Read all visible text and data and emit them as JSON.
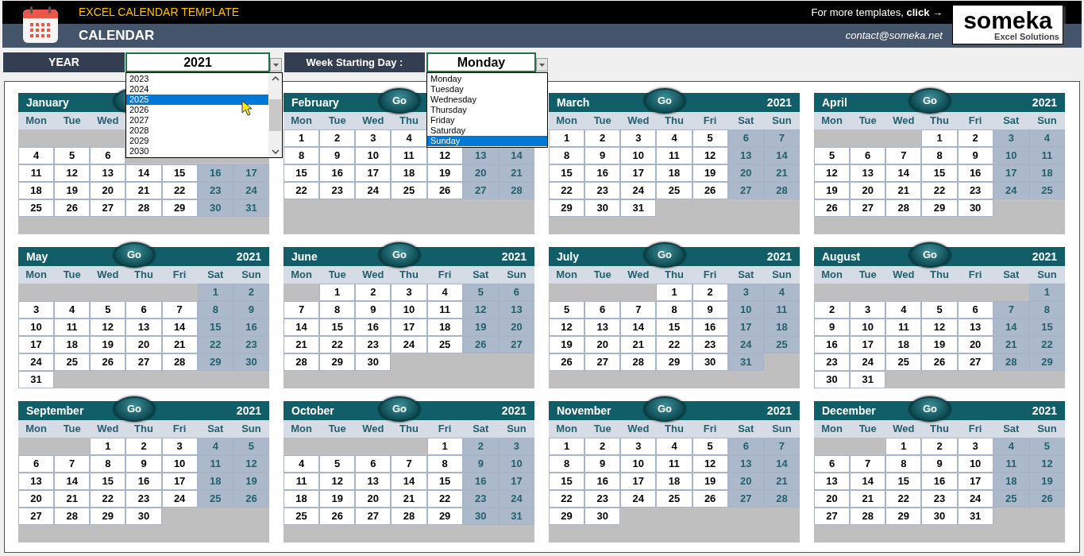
{
  "header": {
    "title": "EXCEL CALENDAR TEMPLATE",
    "subtitle": "CALENDAR",
    "promo": "For more templates, **click** →",
    "contact": "contact@someka.net",
    "logo": {
      "name": "someka",
      "tagline": "Excel Solutions"
    }
  },
  "controls": [
    {
      "label": "YEAR",
      "value": "2021"
    },
    {
      "label": "Week Starting Day :",
      "value": "Monday"
    }
  ],
  "year_dropdown": {
    "options": [
      {
        "label": "2023",
        "selected": false
      },
      {
        "label": "2024",
        "selected": false
      },
      {
        "label": "2025",
        "selected": true
      },
      {
        "label": "2026",
        "selected": false
      },
      {
        "label": "2027",
        "selected": false
      },
      {
        "label": "2028",
        "selected": false
      },
      {
        "label": "2029",
        "selected": false
      },
      {
        "label": "2030",
        "selected": false
      }
    ]
  },
  "weekday_dropdown": {
    "options": [
      {
        "label": "Monday",
        "selected": false
      },
      {
        "label": "Tuesday",
        "selected": false
      },
      {
        "label": "Wednesday",
        "selected": false
      },
      {
        "label": "Thursday",
        "selected": false
      },
      {
        "label": "Friday",
        "selected": false
      },
      {
        "label": "Saturday",
        "selected": false
      },
      {
        "label": "Sunday",
        "selected": true
      }
    ]
  },
  "months": [
    {
      "name": "January",
      "weekdays": [
        "Mon",
        "Tue",
        "Wed"
      ],
      "weeks": [
        {
          "kind": "blank"
        },
        {
          "kind": "week",
          "days": [
            "4",
            "5",
            "6"
          ]
        },
        {
          "kind": "week",
          "days": [
            "11",
            "12",
            "13",
            "14",
            "15",
            "16",
            "17"
          ]
        },
        {
          "kind": "week",
          "days": [
            "18",
            "19",
            "20",
            "21",
            "22",
            "23",
            "24"
          ]
        },
        {
          "kind": "week",
          "days": [
            "25",
            "26",
            "27",
            "28",
            "29",
            "30",
            "31"
          ]
        },
        {
          "kind": "blank"
        }
      ]
    },
    {
      "name": "February",
      "go": "Go",
      "weekdays": [
        "Mon",
        "Tue",
        "Wed",
        "Thu"
      ],
      "weeks": [
        {
          "kind": "week",
          "days": [
            "1",
            "2",
            "3",
            "4"
          ]
        },
        {
          "kind": "week",
          "days": [
            "8",
            "9",
            "10",
            "11",
            "12",
            "13",
            "14"
          ]
        },
        {
          "kind": "week",
          "days": [
            "15",
            "16",
            "17",
            "18",
            "19",
            "20",
            "21"
          ]
        },
        {
          "kind": "week",
          "days": [
            "22",
            "23",
            "24",
            "25",
            "26",
            "27",
            "28"
          ]
        },
        {
          "kind": "blank"
        },
        {
          "kind": "blank"
        }
      ]
    },
    {
      "name": "March",
      "go": "Go",
      "year": "2021",
      "weekdays": [
        "Mon",
        "Tue",
        "Wed",
        "Thu",
        "Fri",
        "Sat",
        "Sun"
      ],
      "weeks": [
        {
          "kind": "week",
          "days": [
            "1",
            "2",
            "3",
            "4",
            "5",
            "6",
            "7"
          ]
        },
        {
          "kind": "week",
          "days": [
            "8",
            "9",
            "10",
            "11",
            "12",
            "13",
            "14"
          ]
        },
        {
          "kind": "week",
          "days": [
            "15",
            "16",
            "17",
            "18",
            "19",
            "20",
            "21"
          ]
        },
        {
          "kind": "week",
          "days": [
            "22",
            "23",
            "24",
            "25",
            "26",
            "27",
            "28"
          ]
        },
        {
          "kind": "week",
          "days": [
            "29",
            "30",
            "31"
          ]
        },
        {
          "kind": "blank"
        }
      ]
    },
    {
      "name": "April",
      "go": "Go",
      "year": "2021",
      "weekdays": [
        "Mon",
        "Tue",
        "Wed",
        "Thu",
        "Fri",
        "Sat",
        "Sun"
      ],
      "weeks": [
        {
          "kind": "week_start",
          "days": [
            "1",
            "2",
            "3",
            "4"
          ]
        },
        {
          "kind": "week",
          "days": [
            "5",
            "6",
            "7",
            "8",
            "9",
            "10",
            "11"
          ]
        },
        {
          "kind": "week",
          "days": [
            "12",
            "13",
            "14",
            "15",
            "16",
            "17",
            "18"
          ]
        },
        {
          "kind": "week",
          "days": [
            "19",
            "20",
            "21",
            "22",
            "23",
            "24",
            "25"
          ]
        },
        {
          "kind": "week",
          "days": [
            "26",
            "27",
            "28",
            "29",
            "30"
          ]
        },
        {
          "kind": "blank"
        }
      ]
    },
    {
      "name": "May",
      "go": "Go",
      "year": "2021",
      "weekdays": [
        "Mon",
        "Tue",
        "Wed",
        "Thu",
        "Fri",
        "Sat",
        "Sun"
      ],
      "weeks": [
        {
          "kind": "week_start",
          "days": [
            "1",
            "2"
          ]
        },
        {
          "kind": "week",
          "days": [
            "3",
            "4",
            "5",
            "6",
            "7",
            "8",
            "9"
          ]
        },
        {
          "kind": "week",
          "days": [
            "10",
            "11",
            "12",
            "13",
            "14",
            "15",
            "16"
          ]
        },
        {
          "kind": "week",
          "days": [
            "17",
            "18",
            "19",
            "20",
            "21",
            "22",
            "23"
          ]
        },
        {
          "kind": "week",
          "days": [
            "24",
            "25",
            "26",
            "27",
            "28",
            "29",
            "30"
          ]
        },
        {
          "kind": "week",
          "days": [
            "31"
          ]
        }
      ]
    },
    {
      "name": "June",
      "go": "Go",
      "year": "2021",
      "weekdays": [
        "Mon",
        "Tue",
        "Wed",
        "Thu",
        "Fri",
        "Sat",
        "Sun"
      ],
      "weeks": [
        {
          "kind": "week_start",
          "days": [
            "1",
            "2",
            "3",
            "4",
            "5",
            "6"
          ]
        },
        {
          "kind": "week",
          "days": [
            "7",
            "8",
            "9",
            "10",
            "11",
            "12",
            "13"
          ]
        },
        {
          "kind": "week",
          "days": [
            "14",
            "15",
            "16",
            "17",
            "18",
            "19",
            "20"
          ]
        },
        {
          "kind": "week",
          "days": [
            "21",
            "22",
            "23",
            "24",
            "25",
            "26",
            "27"
          ]
        },
        {
          "kind": "week",
          "days": [
            "28",
            "29",
            "30"
          ]
        },
        {
          "kind": "blank"
        }
      ]
    },
    {
      "name": "July",
      "go": "Go",
      "year": "2021",
      "weekdays": [
        "Mon",
        "Tue",
        "Wed",
        "Thu",
        "Fri",
        "Sat",
        "Sun"
      ],
      "weeks": [
        {
          "kind": "week_start",
          "days": [
            "1",
            "2",
            "3",
            "4"
          ]
        },
        {
          "kind": "week",
          "days": [
            "5",
            "6",
            "7",
            "8",
            "9",
            "10",
            "11"
          ]
        },
        {
          "kind": "week",
          "days": [
            "12",
            "13",
            "14",
            "15",
            "16",
            "17",
            "18"
          ]
        },
        {
          "kind": "week",
          "days": [
            "19",
            "20",
            "21",
            "22",
            "23",
            "24",
            "25"
          ]
        },
        {
          "kind": "week",
          "days": [
            "26",
            "27",
            "28",
            "29",
            "30",
            "31"
          ]
        },
        {
          "kind": "blank"
        }
      ]
    },
    {
      "name": "August",
      "go": "Go",
      "year": "2021",
      "weekdays": [
        "Mon",
        "Tue",
        "Wed",
        "Thu",
        "Fri",
        "Sat",
        "Sun"
      ],
      "weeks": [
        {
          "kind": "week_start",
          "days": [
            "1"
          ]
        },
        {
          "kind": "week",
          "days": [
            "2",
            "3",
            "4",
            "5",
            "6",
            "7",
            "8"
          ]
        },
        {
          "kind": "week",
          "days": [
            "9",
            "10",
            "11",
            "12",
            "13",
            "14",
            "15"
          ]
        },
        {
          "kind": "week",
          "days": [
            "16",
            "17",
            "18",
            "19",
            "20",
            "21",
            "22"
          ]
        },
        {
          "kind": "week",
          "days": [
            "23",
            "24",
            "25",
            "26",
            "27",
            "28",
            "29"
          ]
        },
        {
          "kind": "week",
          "days": [
            "30",
            "31"
          ]
        }
      ]
    },
    {
      "name": "September",
      "go": "Go",
      "year": "2021",
      "weekdays": [
        "Mon",
        "Tue",
        "Wed",
        "Thu",
        "Fri",
        "Sat",
        "Sun"
      ],
      "weeks": [
        {
          "kind": "week_start",
          "days": [
            "1",
            "2",
            "3",
            "4",
            "5"
          ]
        },
        {
          "kind": "week",
          "days": [
            "6",
            "7",
            "8",
            "9",
            "10",
            "11",
            "12"
          ]
        },
        {
          "kind": "week",
          "days": [
            "13",
            "14",
            "15",
            "16",
            "17",
            "18",
            "19"
          ]
        },
        {
          "kind": "week",
          "days": [
            "20",
            "21",
            "22",
            "23",
            "24",
            "25",
            "26"
          ]
        },
        {
          "kind": "week",
          "days": [
            "27",
            "28",
            "29",
            "30"
          ]
        },
        {
          "kind": "blank"
        }
      ]
    },
    {
      "name": "October",
      "go": "Go",
      "year": "2021",
      "weekdays": [
        "Mon",
        "Tue",
        "Wed",
        "Thu",
        "Fri",
        "Sat",
        "Sun"
      ],
      "weeks": [
        {
          "kind": "week_start",
          "days": [
            "1",
            "2",
            "3"
          ]
        },
        {
          "kind": "week",
          "days": [
            "4",
            "5",
            "6",
            "7",
            "8",
            "9",
            "10"
          ]
        },
        {
          "kind": "week",
          "days": [
            "11",
            "12",
            "13",
            "14",
            "15",
            "16",
            "17"
          ]
        },
        {
          "kind": "week",
          "days": [
            "18",
            "19",
            "20",
            "21",
            "22",
            "23",
            "24"
          ]
        },
        {
          "kind": "week",
          "days": [
            "25",
            "26",
            "27",
            "28",
            "29",
            "30",
            "31"
          ]
        },
        {
          "kind": "blank"
        }
      ]
    },
    {
      "name": "November",
      "go": "Go",
      "year": "2021",
      "weekdays": [
        "Mon",
        "Tue",
        "Wed",
        "Thu",
        "Fri",
        "Sat",
        "Sun"
      ],
      "weeks": [
        {
          "kind": "week",
          "days": [
            "1",
            "2",
            "3",
            "4",
            "5",
            "6",
            "7"
          ]
        },
        {
          "kind": "week",
          "days": [
            "8",
            "9",
            "10",
            "11",
            "12",
            "13",
            "14"
          ]
        },
        {
          "kind": "week",
          "days": [
            "15",
            "16",
            "17",
            "18",
            "19",
            "20",
            "21"
          ]
        },
        {
          "kind": "week",
          "days": [
            "22",
            "23",
            "24",
            "25",
            "26",
            "27",
            "28"
          ]
        },
        {
          "kind": "week",
          "days": [
            "29",
            "30"
          ]
        },
        {
          "kind": "blank"
        }
      ]
    },
    {
      "name": "December",
      "go": "Go",
      "year": "2021",
      "weekdays": [
        "Mon",
        "Tue",
        "Wed",
        "Thu",
        "Fri",
        "Sat",
        "Sun"
      ],
      "weeks": [
        {
          "kind": "week_start",
          "days": [
            "1",
            "2",
            "3",
            "4",
            "5"
          ]
        },
        {
          "kind": "week",
          "days": [
            "6",
            "7",
            "8",
            "9",
            "10",
            "11",
            "12"
          ]
        },
        {
          "kind": "week",
          "days": [
            "13",
            "14",
            "15",
            "16",
            "17",
            "18",
            "19"
          ]
        },
        {
          "kind": "week",
          "days": [
            "20",
            "21",
            "22",
            "23",
            "24",
            "25",
            "26"
          ]
        },
        {
          "kind": "week",
          "days": [
            "27",
            "28",
            "29",
            "30",
            "31"
          ]
        },
        {
          "kind": "blank"
        }
      ]
    }
  ]
}
